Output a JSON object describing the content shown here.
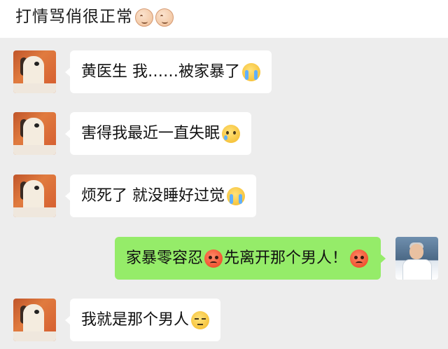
{
  "header": {
    "title": "打情骂俏很正常",
    "trailing_icons": [
      "smirk-face-icon",
      "smirk-face-icon"
    ]
  },
  "messages": [
    {
      "side": "left",
      "sender": "patient",
      "avatar": "cartoon-dog-avatar",
      "text": "黄医生 我……被家暴了",
      "emoji": "loudly-crying-face-icon"
    },
    {
      "side": "left",
      "sender": "patient",
      "avatar": "cartoon-dog-avatar",
      "text": "害得我最近一直失眠",
      "emoji": "crying-face-icon"
    },
    {
      "side": "left",
      "sender": "patient",
      "avatar": "cartoon-dog-avatar",
      "text": "烦死了 就没睡好过觉",
      "emoji": "loudly-crying-face-icon"
    },
    {
      "side": "right",
      "sender": "doctor",
      "avatar": "doctor-avatar",
      "text_a": "家暴零容忍",
      "emoji_a": "angry-face-icon",
      "text_b": "先离开那个男人！",
      "emoji_b": "angry-face-icon"
    },
    {
      "side": "left",
      "sender": "patient",
      "avatar": "cartoon-dog-avatar",
      "text": "我就是那个男人",
      "emoji": "unamused-face-icon"
    }
  ],
  "colors": {
    "background": "#ededed",
    "header_bg": "#ffffff",
    "bubble_left": "#ffffff",
    "bubble_right": "#95ec69"
  }
}
